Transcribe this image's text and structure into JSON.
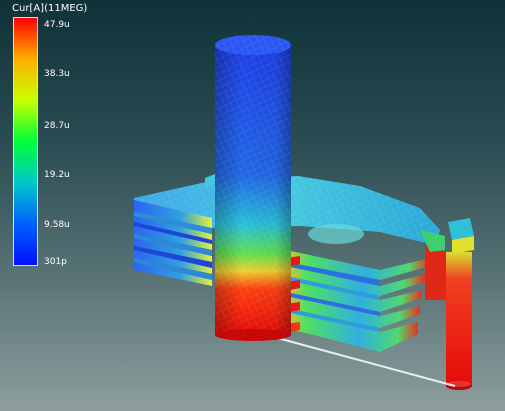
{
  "legend": {
    "title": "Cur[A](11MEG)",
    "ticks": [
      "47.9u",
      "38.3u",
      "28.7u",
      "19.2u",
      "9.58u",
      "301p"
    ],
    "gradient": [
      "#ff0000",
      "#ffb000",
      "#c8ff00",
      "#00ff3a",
      "#00c8c8",
      "#0060ff",
      "#0010ff"
    ]
  },
  "scene": {
    "model_colors": {
      "low": "#1a4fe0",
      "mid_low": "#2fb8d8",
      "mid": "#4fe060",
      "mid_high": "#f0e030",
      "high": "#ee1010"
    }
  }
}
